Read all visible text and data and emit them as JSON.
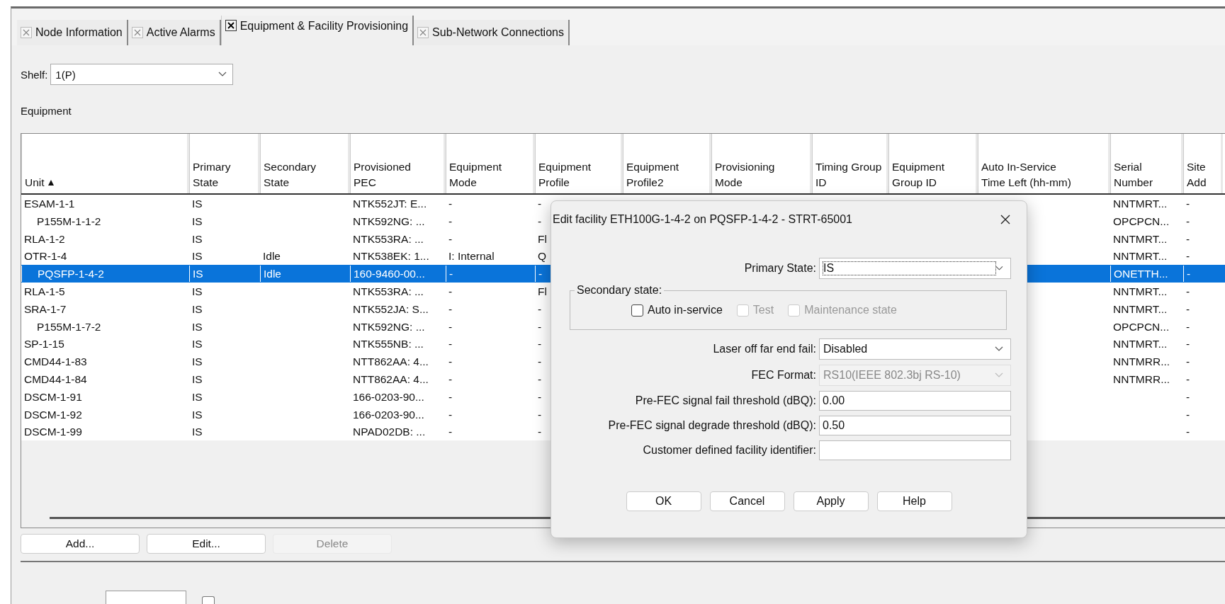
{
  "tabs": [
    {
      "label": "Node Information",
      "selected": false
    },
    {
      "label": "Active Alarms",
      "selected": false
    },
    {
      "label": "Equipment & Facility Provisioning",
      "selected": true
    },
    {
      "label": "Sub-Network Connections",
      "selected": false
    }
  ],
  "shelf": {
    "label": "Shelf:",
    "value": "1(P)"
  },
  "equipment": {
    "title": "Equipment",
    "columns": [
      {
        "label": "Unit",
        "sorted": true
      },
      {
        "label": "Primary State",
        "sorted": false
      },
      {
        "label": "Secondary State",
        "sorted": false
      },
      {
        "label": "Provisioned PEC",
        "sorted": false
      },
      {
        "label": "Equipment Mode",
        "sorted": false
      },
      {
        "label": "Equipment Profile",
        "sorted": false
      },
      {
        "label": "Equipment Profile2",
        "sorted": false
      },
      {
        "label": "Provisioning Mode",
        "sorted": false
      },
      {
        "label": "Timing Group ID",
        "sorted": false
      },
      {
        "label": "Equipment Group ID",
        "sorted": false
      },
      {
        "label": "Auto In-Service Time Left (hh-mm)",
        "sorted": false
      },
      {
        "label": "Serial Number",
        "sorted": false
      },
      {
        "label": "Site Add",
        "sorted": false
      }
    ],
    "rows": [
      {
        "unit": "ESAM-1-1",
        "primary_state": "IS",
        "pec": "NTK552JT: E...",
        "mode": "-",
        "profile": "-",
        "serial": "NNTMRT...",
        "site": "-",
        "selected": false,
        "children": [
          {
            "unit": "P155M-1-1-2",
            "primary_state": "IS",
            "pec": "NTK592NG: ...",
            "mode": "-",
            "profile": "-",
            "serial": "OPCPCN...",
            "site": "-",
            "selected": false
          }
        ]
      },
      {
        "unit": "RLA-1-2",
        "primary_state": "IS",
        "pec": "NTK553RA: ...",
        "mode": "-",
        "profile": "Fl",
        "serial": "NNTMRT...",
        "site": "-",
        "selected": false
      },
      {
        "unit": "OTR-1-4",
        "primary_state": "IS",
        "secondary_state": "Idle",
        "pec": "NTK538EK: 1...",
        "mode": "I: Internal",
        "profile": "Q",
        "serial": "NNTMRT...",
        "site": "-",
        "selected": false,
        "children": [
          {
            "unit": "PQSFP-1-4-2",
            "primary_state": "IS",
            "secondary_state": "Idle",
            "pec": "160-9460-00...",
            "mode": "-",
            "profile": "-",
            "serial": "ONETTH...",
            "site": "-",
            "selected": true
          }
        ]
      },
      {
        "unit": "RLA-1-5",
        "primary_state": "IS",
        "pec": "NTK553RA: ...",
        "mode": "-",
        "profile": "Fl",
        "serial": "NNTMRT...",
        "site": "-",
        "selected": false
      },
      {
        "unit": "SRA-1-7",
        "primary_state": "IS",
        "pec": "NTK552JA: S...",
        "mode": "-",
        "profile": "-",
        "serial": "NNTMRT...",
        "site": "-",
        "selected": false,
        "children": [
          {
            "unit": "P155M-1-7-2",
            "primary_state": "IS",
            "pec": "NTK592NG: ...",
            "mode": "-",
            "profile": "-",
            "serial": "OPCPCN...",
            "site": "-",
            "selected": false
          }
        ]
      },
      {
        "unit": "SP-1-15",
        "primary_state": "IS",
        "pec": "NTK555NB: ...",
        "mode": "-",
        "profile": "-",
        "serial": "NNTMRT...",
        "site": "-",
        "selected": false
      },
      {
        "unit": "CMD44-1-83",
        "primary_state": "IS",
        "pec": "NTT862AA: 4...",
        "mode": "-",
        "profile": "-",
        "serial": "NNTMRR...",
        "site": "-",
        "selected": false
      },
      {
        "unit": "CMD44-1-84",
        "primary_state": "IS",
        "pec": "NTT862AA: 4...",
        "mode": "-",
        "profile": "-",
        "serial": "NNTMRR...",
        "site": "-",
        "selected": false
      },
      {
        "unit": "DSCM-1-91",
        "primary_state": "IS",
        "pec": "166-0203-90...",
        "mode": "-",
        "profile": "-",
        "site": "-",
        "selected": false
      },
      {
        "unit": "DSCM-1-92",
        "primary_state": "IS",
        "pec": "166-0203-90...",
        "mode": "-",
        "profile": "-",
        "site": "-",
        "selected": false
      },
      {
        "unit": "DSCM-1-99",
        "primary_state": "IS",
        "pec": "NPAD02DB: ...",
        "mode": "-",
        "profile": "-",
        "site": "-",
        "selected": false
      }
    ],
    "buttons": [
      {
        "label": "Add...",
        "disabled": false
      },
      {
        "label": "Edit...",
        "disabled": false
      },
      {
        "label": "Delete",
        "disabled": true
      }
    ]
  },
  "bottom_checkbox": {
    "checked": false
  },
  "dialog": {
    "title": "Edit facility ETH100G-1-4-2 on PQSFP-1-4-2 - STRT-65001",
    "primary_state": {
      "label": "Primary State:",
      "value": "IS",
      "focused": true
    },
    "secondary_state": {
      "title": "Secondary state:",
      "options": [
        {
          "label": "Auto in-service",
          "checked": false,
          "disabled": false
        },
        {
          "label": "Test",
          "checked": false,
          "disabled": true
        },
        {
          "label": "Maintenance state",
          "checked": false,
          "disabled": true
        }
      ]
    },
    "fields": [
      {
        "kind": "select",
        "label": "Laser off far end fail:",
        "value": "Disabled",
        "disabled": false
      },
      {
        "kind": "select",
        "label": "FEC Format:",
        "value": "RS10(IEEE 802.3bj RS-10)",
        "disabled": true
      },
      {
        "kind": "text",
        "label": "Pre-FEC signal fail threshold (dBQ):",
        "value": "0.00"
      },
      {
        "kind": "text",
        "label": "Pre-FEC signal degrade threshold (dBQ):",
        "value": "0.50"
      },
      {
        "kind": "text",
        "label": "Customer defined facility identifier:"
      }
    ],
    "buttons": [
      "OK",
      "Cancel",
      "Apply",
      "Help"
    ]
  }
}
